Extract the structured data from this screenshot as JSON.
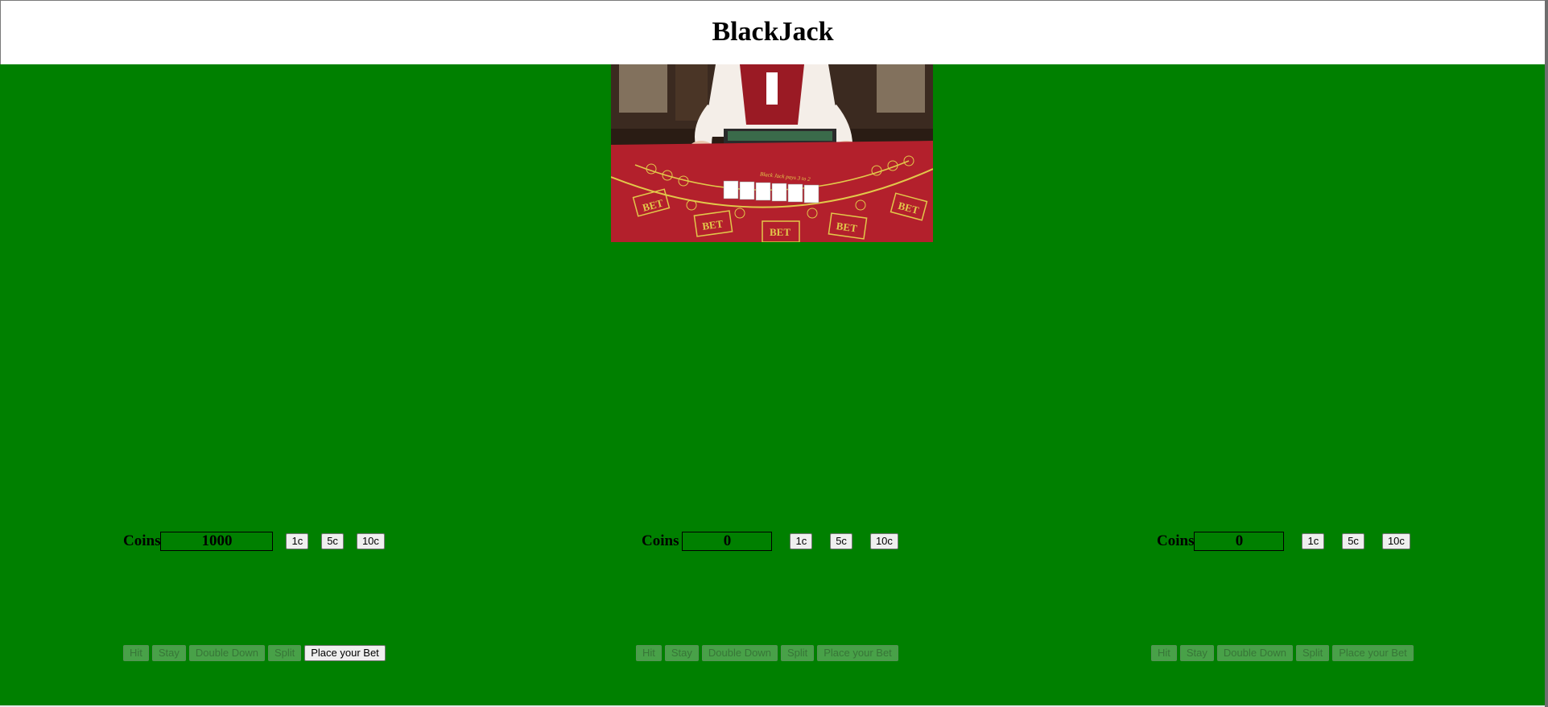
{
  "header": {
    "title": "BlackJack"
  },
  "dealer": {
    "table_texts": [
      "BET",
      "BET",
      "BET",
      "BET",
      "BET",
      "Black Jack pays 3 to 2"
    ]
  },
  "players": [
    {
      "coins_label": "Coins",
      "coins_value": "1000",
      "chips": [
        "1c",
        "5c",
        "10c"
      ],
      "actions": {
        "hit": "Hit",
        "stay": "Stay",
        "double_down": "Double Down",
        "split": "Split",
        "place_bet": "Place your Bet"
      }
    },
    {
      "coins_label": "Coins",
      "coins_value": "0",
      "chips": [
        "1c",
        "5c",
        "10c"
      ],
      "actions": {
        "hit": "Hit",
        "stay": "Stay",
        "double_down": "Double Down",
        "split": "Split",
        "place_bet": "Place your Bet"
      }
    },
    {
      "coins_label": "Coins",
      "coins_value": "0",
      "chips": [
        "1c",
        "5c",
        "10c"
      ],
      "actions": {
        "hit": "Hit",
        "stay": "Stay",
        "double_down": "Double Down",
        "split": "Split",
        "place_bet": "Place your Bet"
      }
    }
  ],
  "colors": {
    "table_green": "#008000",
    "felt_red": "#b3202c"
  }
}
